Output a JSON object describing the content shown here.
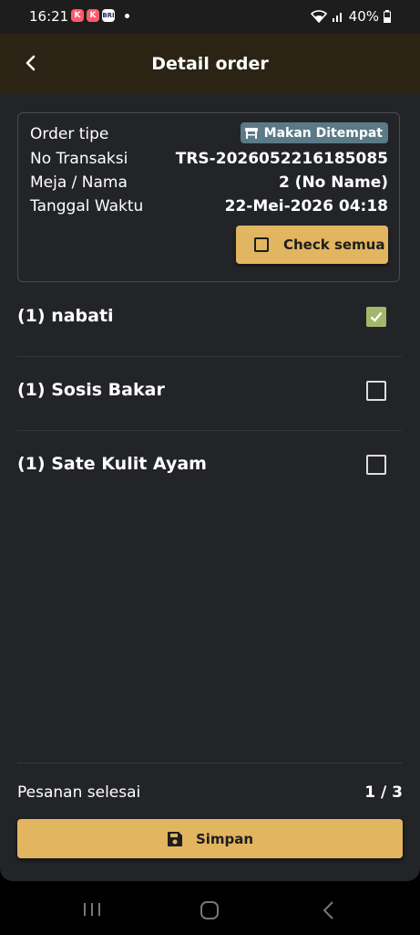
{
  "status_bar": {
    "time": "16:21",
    "app_icons": [
      "K",
      "K",
      "BRI"
    ],
    "battery": "40%"
  },
  "header": {
    "title": "Detail order"
  },
  "order_info": {
    "order_type_label": "Order tipe",
    "order_type_value": "Makan Ditempat",
    "transaction_label": "No Transaksi",
    "transaction_value": "TRS-2026052216185085",
    "table_label": "Meja / Nama",
    "table_value": "2 (No Name)",
    "datetime_label": "Tanggal Waktu",
    "datetime_value": "22-Mei-2026 04:18",
    "check_all_label": "Check semua"
  },
  "items": [
    {
      "label": "(1) nabati",
      "checked": true
    },
    {
      "label": "(1) Sosis Bakar",
      "checked": false
    },
    {
      "label": "(1) Sate Kulit Ayam",
      "checked": false
    }
  ],
  "footer": {
    "done_label": "Pesanan selesai",
    "done_value": "1 / 3",
    "save_label": "Simpan"
  },
  "colors": {
    "accent": "#e2b560",
    "badge": "#5b7a87",
    "checked": "#a3b76a"
  }
}
